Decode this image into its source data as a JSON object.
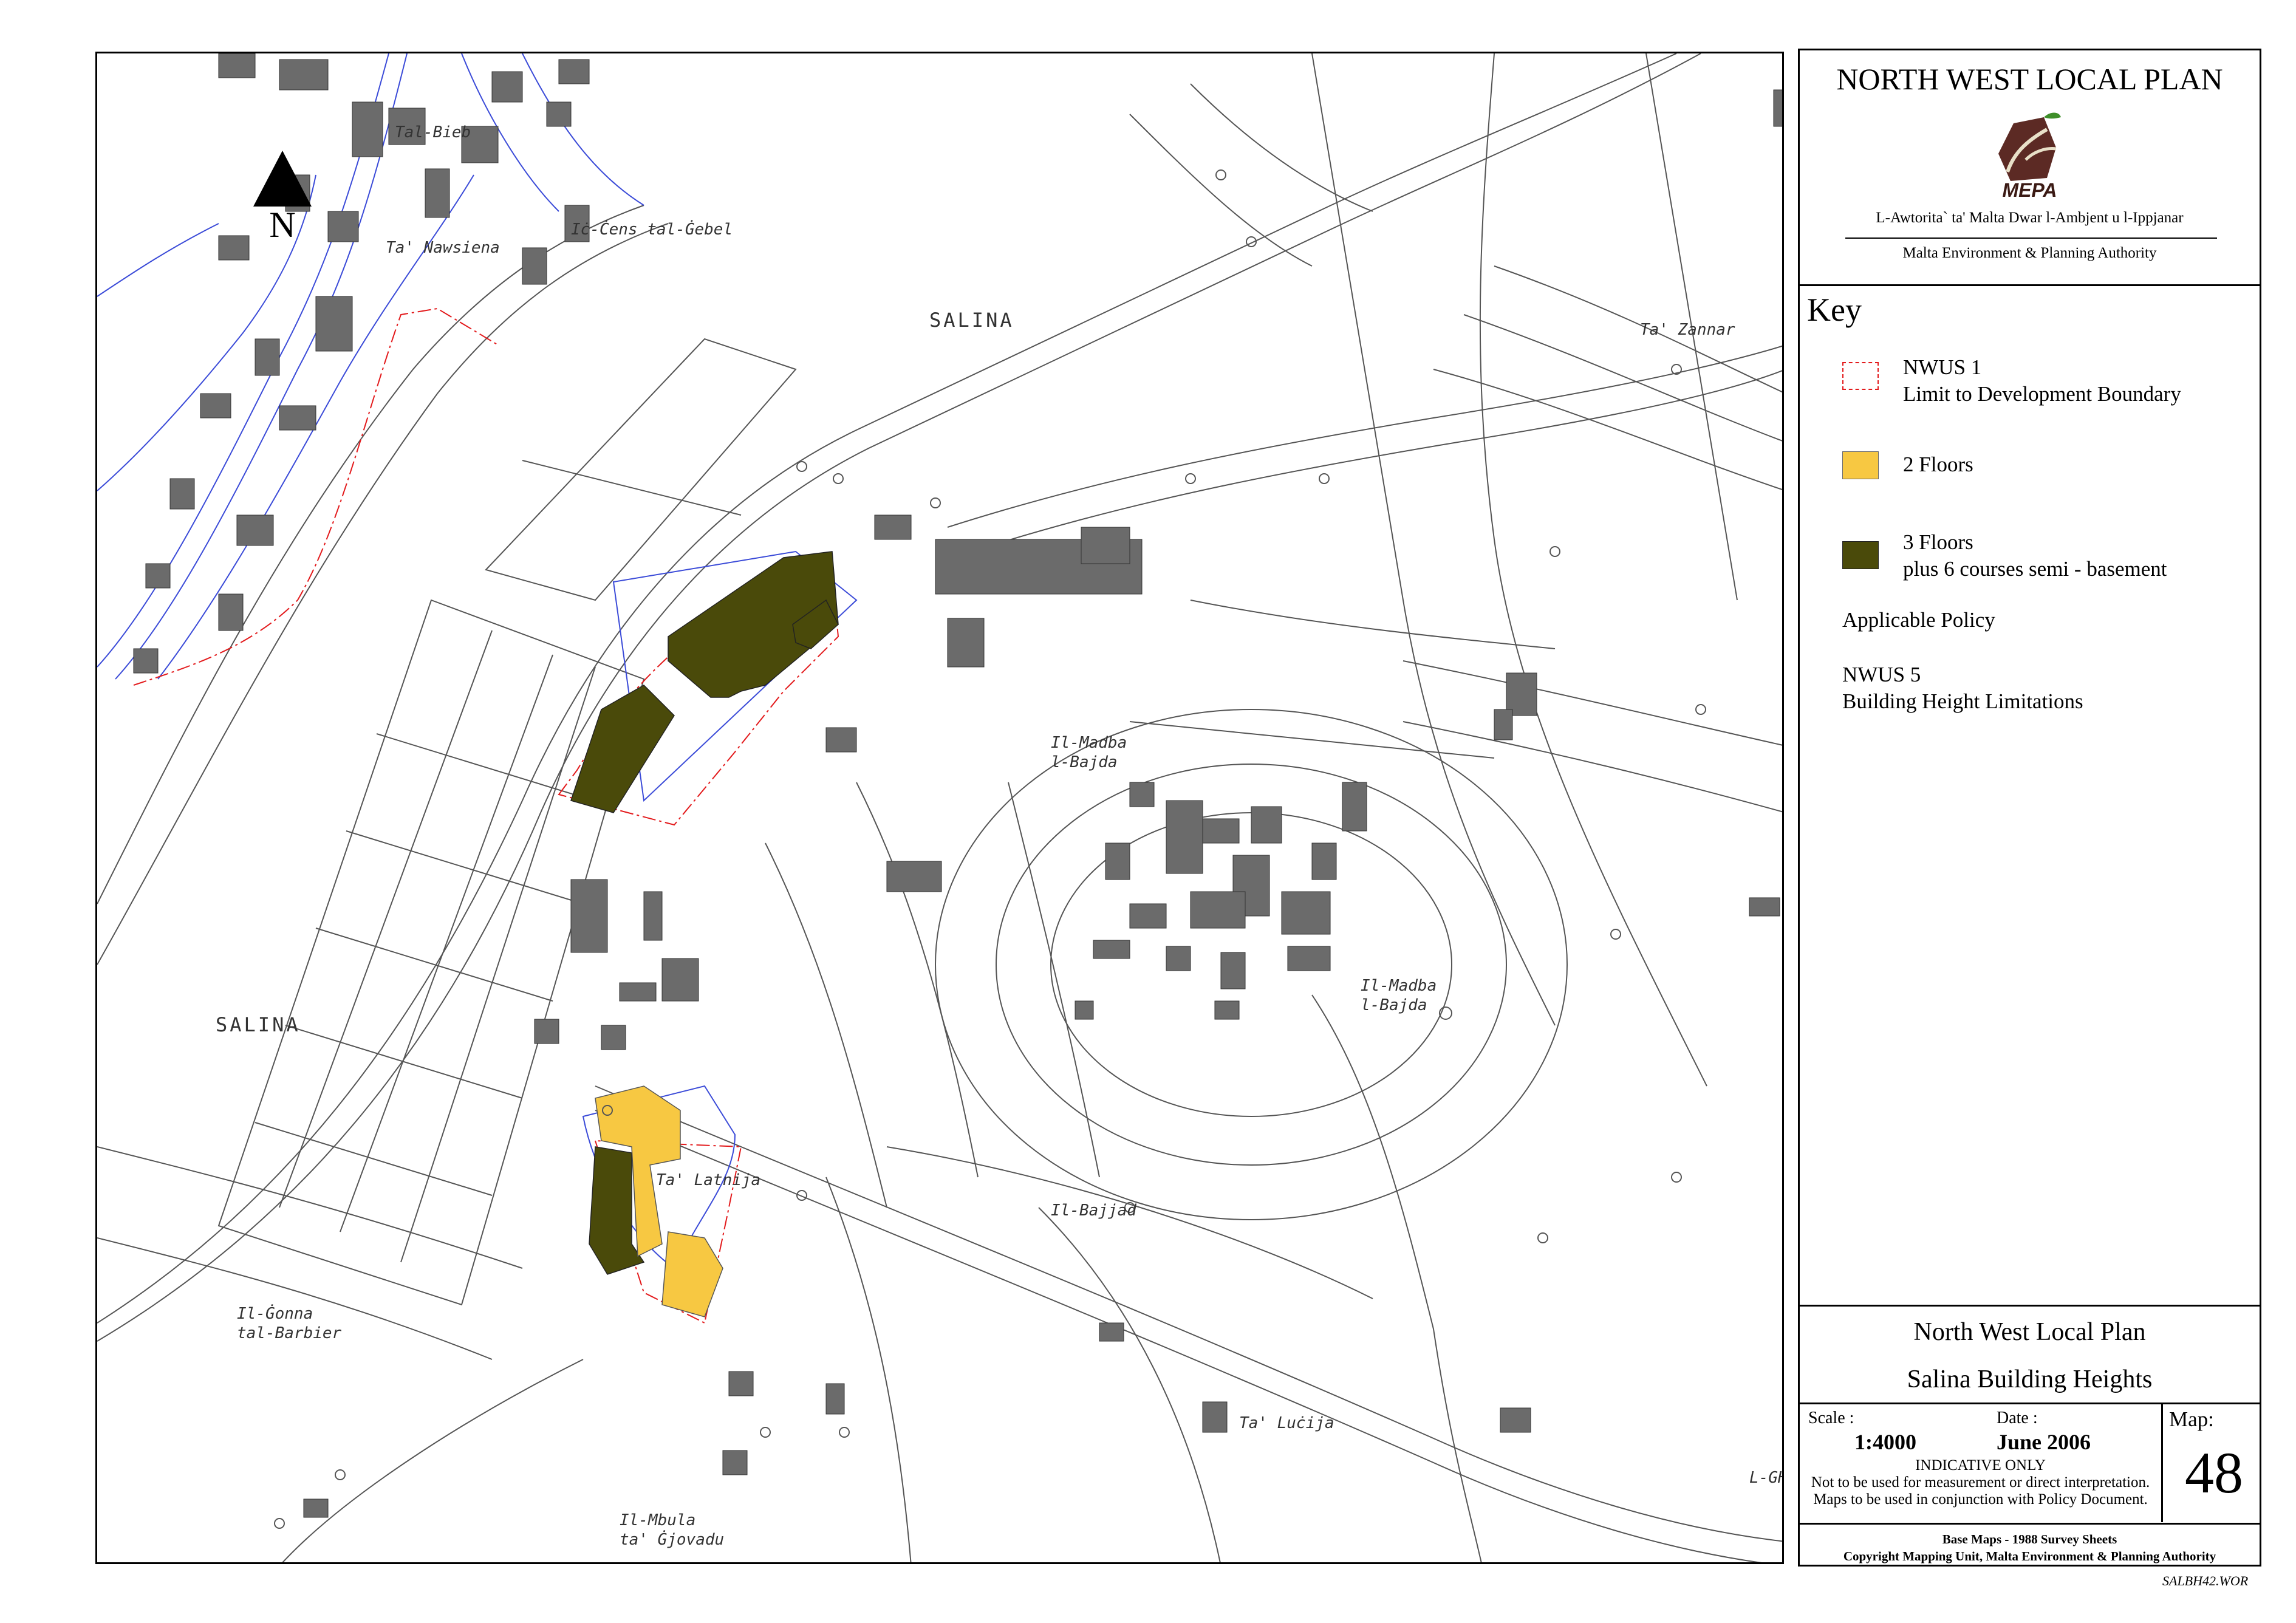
{
  "north_arrow": {
    "letter": "N"
  },
  "map_labels": {
    "salina_top": "SALINA",
    "salina_left": "SALINA",
    "ic_cens": "Iċ-Ċens tal-Ġebel",
    "il_modba_1": "Il-Madba",
    "il_bajda_1": "l-Bajda",
    "il_modba_2": "Il-Madba",
    "il_bajda_2": "l-Bajda",
    "ta_latnija": "Ta' Latnija",
    "il_bajjad": "Il-Bajjad",
    "il_gonna": "Il-Ġonna",
    "tal_barbier": "tal-Barbier",
    "ta_lucija": "Ta' Luċija",
    "il_mbula": "Il-Mbula",
    "ta_gjovadu": "ta' Ġjovadu",
    "ta_zannar": "Ta' Zannar",
    "tal_bieb": "Tal-Bieb",
    "ta_nawsiena": "Ta' Nawsiena",
    "l_gh": "L-GH"
  },
  "panel": {
    "plan_title": "NORTH WEST LOCAL PLAN",
    "logo_text": "MEPA",
    "authority_mt": "L-Awtorita` ta' Malta Dwar l-Ambjent u l-Ippjanar",
    "authority_en": "Malta Environment & Planning Authority"
  },
  "key": {
    "title": "Key",
    "items": [
      {
        "line1": "NWUS 1",
        "line2": "Limit to Development Boundary",
        "color": "#e31a1c"
      },
      {
        "line1": "2 Floors",
        "color": "#f7c842"
      },
      {
        "line1": "3 Floors",
        "line2": "plus 6 courses semi - basement",
        "color": "#4a4a0a"
      }
    ],
    "applicable_policy": "Applicable Policy",
    "policy_code": "NWUS 5",
    "policy_name": "Building Height Limitations"
  },
  "info": {
    "plan_name": "North West Local Plan",
    "map_title": "Salina Building Heights",
    "scale_label": "Scale :",
    "scale_value": "1:4000",
    "date_label": "Date :",
    "date_value": "June 2006",
    "map_label": "Map:",
    "map_number": "48",
    "indicative": "INDICATIVE ONLY",
    "disclaimer_1": "Not to be used for measurement or direct interpretation.",
    "disclaimer_2": "Maps to be used in conjunction with Policy Document.",
    "base_maps": "Base Maps - 1988 Survey Sheets",
    "copyright": "Copyright Mapping Unit, Malta Environment & Planning Authority"
  },
  "file_ref": "SALBH42.WOR"
}
